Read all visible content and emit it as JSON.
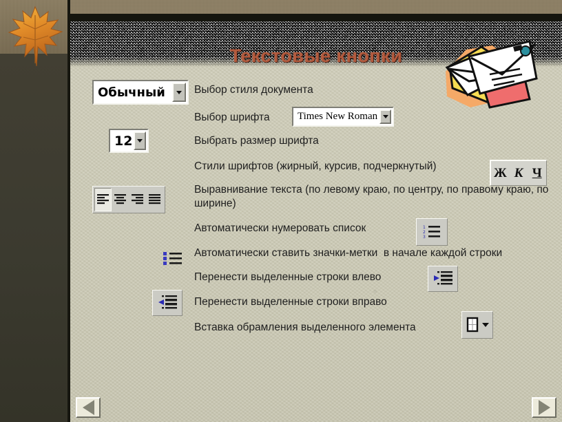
{
  "slide": {
    "title": "Текстовые кнопки",
    "title_color": "#b45b3e",
    "panel_bg": "#cdcbb7",
    "band_bg": "#15150e"
  },
  "controls": {
    "style_combo": {
      "name": "style-combo",
      "value": "Обычный",
      "arrow": "chevron-down-icon"
    },
    "size_combo": {
      "name": "font-size-combo",
      "value": "12",
      "arrow": "chevron-down-icon"
    },
    "font_combo": {
      "name": "font-name-combo",
      "value": "Times New Roman",
      "arrow": "chevron-down-icon"
    },
    "font_style_buttons": {
      "bold": "Ж",
      "italic": "К",
      "underline": "Ч"
    },
    "align_buttons": [
      {
        "name": "align-left-button",
        "icon": "align-left-icon",
        "pressed": true
      },
      {
        "name": "align-center-button",
        "icon": "align-center-icon",
        "pressed": false
      },
      {
        "name": "align-right-button",
        "icon": "align-right-icon",
        "pressed": false
      },
      {
        "name": "align-justify-button",
        "icon": "align-justify-icon",
        "pressed": false
      }
    ],
    "numbered_list_button": {
      "name": "numbered-list-button",
      "icon": "numbered-list-icon"
    },
    "bulleted_list_button": {
      "name": "bulleted-list-button",
      "icon": "bulleted-list-icon"
    },
    "indent_left_button": {
      "name": "decrease-indent-button",
      "icon": "decrease-indent-icon"
    },
    "indent_right_button": {
      "name": "increase-indent-button",
      "icon": "increase-indent-icon"
    },
    "borders_button": {
      "name": "borders-button",
      "icon": "borders-icon",
      "arrow": "chevron-down-icon"
    }
  },
  "descriptions": {
    "style": "Выбор стиля документа",
    "font": "Выбор шрифта",
    "size": "Выбрать размер шрифта",
    "font_styles": "Стили шрифтов (жирный, курсив, подчеркнутый)",
    "alignment": "Выравнивание текста (по левому краю, по центру, по правому краю, по ширине)",
    "numbering": "Автоматически нумеровать список",
    "bullets": "Автоматически ставить значки-метки  в начале каждой строки",
    "indent_left": "Перенести выделенные строки влево",
    "indent_right": "Перенести выделенные строки вправо",
    "borders": "Вставка обрамления выделенного элемента"
  },
  "navigation": {
    "prev": {
      "name": "previous-slide-button",
      "icon": "triangle-left-icon"
    },
    "next": {
      "name": "next-slide-button",
      "icon": "triangle-right-icon"
    }
  },
  "decorations": {
    "leaf": "maple-leaf-image",
    "envelopes": "envelopes-clipart-image"
  }
}
